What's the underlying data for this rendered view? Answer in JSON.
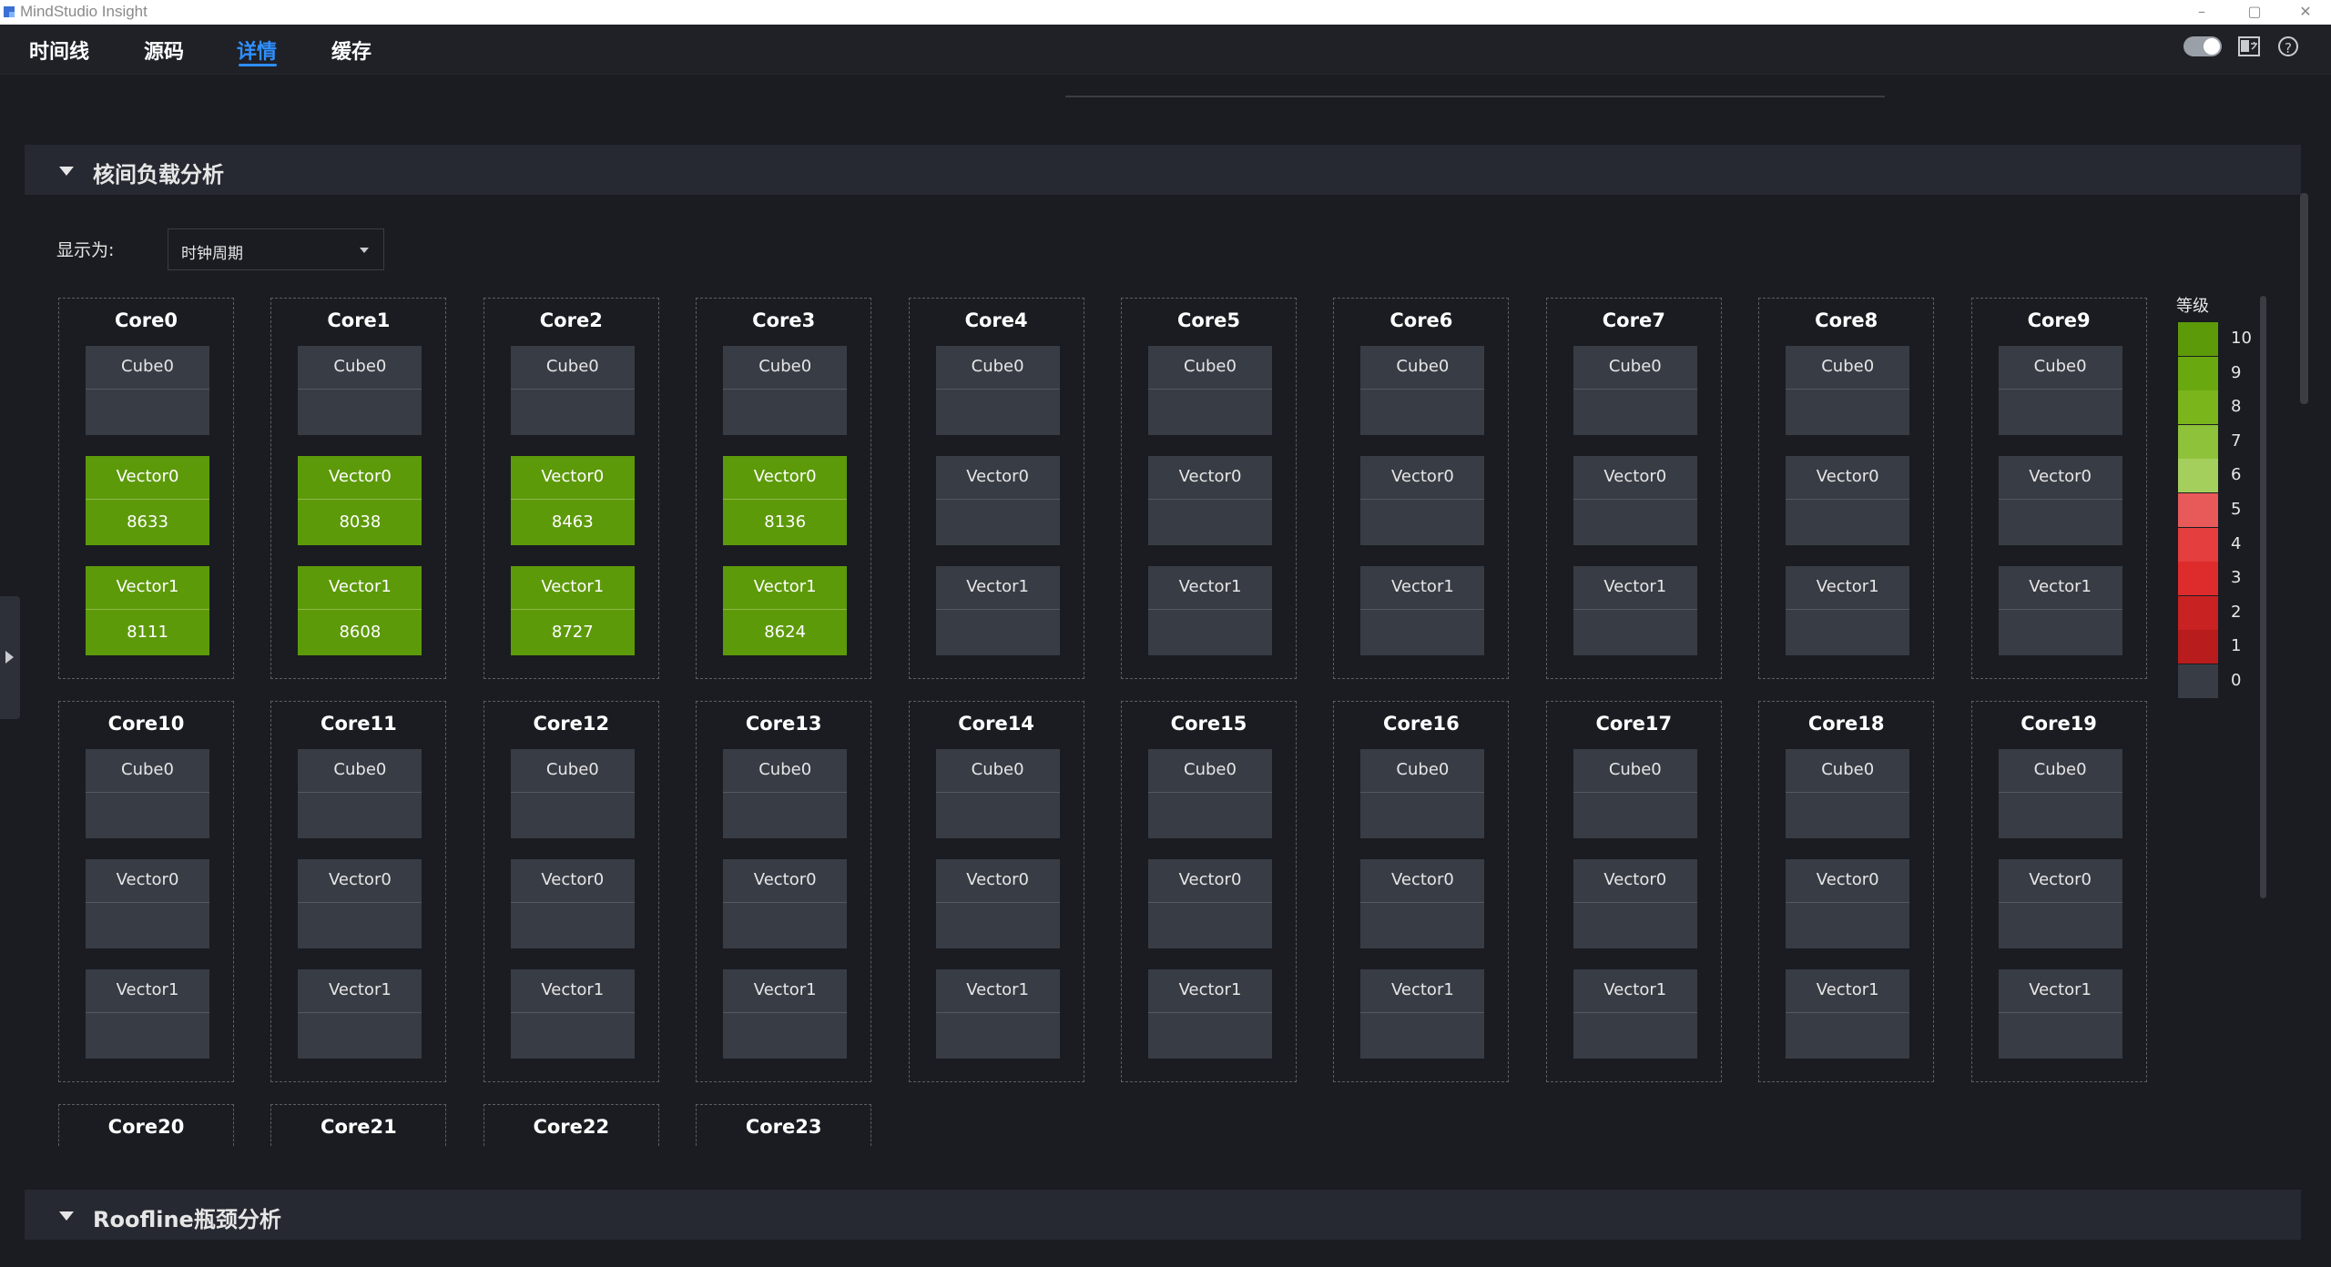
{
  "window": {
    "title": "MindStudio Insight",
    "controls": [
      "–",
      "▢",
      "✕"
    ]
  },
  "nav": {
    "tabs": [
      {
        "label": "时间线"
      },
      {
        "label": "源码"
      },
      {
        "label": "详情"
      },
      {
        "label": "缓存"
      }
    ],
    "active_tab": "详情",
    "help_icon_glyph": "?"
  },
  "section_core_load": {
    "title": "核间负载分析",
    "display_label": "显示为:",
    "display_select_value": "时钟周期"
  },
  "cores": [
    {
      "name": "Core0",
      "cube0": "",
      "vector0": "8633",
      "vector1": "8111"
    },
    {
      "name": "Core1",
      "cube0": "",
      "vector0": "8038",
      "vector1": "8608"
    },
    {
      "name": "Core2",
      "cube0": "",
      "vector0": "8463",
      "vector1": "8727"
    },
    {
      "name": "Core3",
      "cube0": "",
      "vector0": "8136",
      "vector1": "8624"
    },
    {
      "name": "Core4",
      "cube0": "",
      "vector0": "",
      "vector1": ""
    },
    {
      "name": "Core5",
      "cube0": "",
      "vector0": "",
      "vector1": ""
    },
    {
      "name": "Core6",
      "cube0": "",
      "vector0": "",
      "vector1": ""
    },
    {
      "name": "Core7",
      "cube0": "",
      "vector0": "",
      "vector1": ""
    },
    {
      "name": "Core8",
      "cube0": "",
      "vector0": "",
      "vector1": ""
    },
    {
      "name": "Core9",
      "cube0": "",
      "vector0": "",
      "vector1": ""
    },
    {
      "name": "Core10",
      "cube0": "",
      "vector0": "",
      "vector1": ""
    },
    {
      "name": "Core11",
      "cube0": "",
      "vector0": "",
      "vector1": ""
    },
    {
      "name": "Core12",
      "cube0": "",
      "vector0": "",
      "vector1": ""
    },
    {
      "name": "Core13",
      "cube0": "",
      "vector0": "",
      "vector1": ""
    },
    {
      "name": "Core14",
      "cube0": "",
      "vector0": "",
      "vector1": ""
    },
    {
      "name": "Core15",
      "cube0": "",
      "vector0": "",
      "vector1": ""
    },
    {
      "name": "Core16",
      "cube0": "",
      "vector0": "",
      "vector1": ""
    },
    {
      "name": "Core17",
      "cube0": "",
      "vector0": "",
      "vector1": ""
    },
    {
      "name": "Core18",
      "cube0": "",
      "vector0": "",
      "vector1": ""
    },
    {
      "name": "Core19",
      "cube0": "",
      "vector0": "",
      "vector1": ""
    },
    {
      "name": "Core20"
    },
    {
      "name": "Core21"
    },
    {
      "name": "Core22"
    },
    {
      "name": "Core23"
    }
  ],
  "unit_labels": {
    "cube0": "Cube0",
    "vector0": "Vector0",
    "vector1": "Vector1"
  },
  "legend": {
    "title": "等级",
    "levels": [
      {
        "label": "10",
        "color": "#5d9a0a"
      },
      {
        "label": "9",
        "color": "#6aa80f"
      },
      {
        "label": "8",
        "color": "#7ab51c"
      },
      {
        "label": "7",
        "color": "#8ec23a"
      },
      {
        "label": "6",
        "color": "#a5cf5c"
      },
      {
        "label": "5",
        "color": "#e85a5a"
      },
      {
        "label": "4",
        "color": "#e43e3e"
      },
      {
        "label": "3",
        "color": "#de2b2b"
      },
      {
        "label": "2",
        "color": "#c92222"
      },
      {
        "label": "1",
        "color": "#b81c1c"
      },
      {
        "label": "0",
        "color": "#383c45"
      }
    ]
  },
  "section_roofline": {
    "title": "Roofline瓶颈分析"
  },
  "colors": {
    "accent": "#2f8fff",
    "active_unit": "#5d9a0a",
    "idle_unit": "#383c45"
  }
}
